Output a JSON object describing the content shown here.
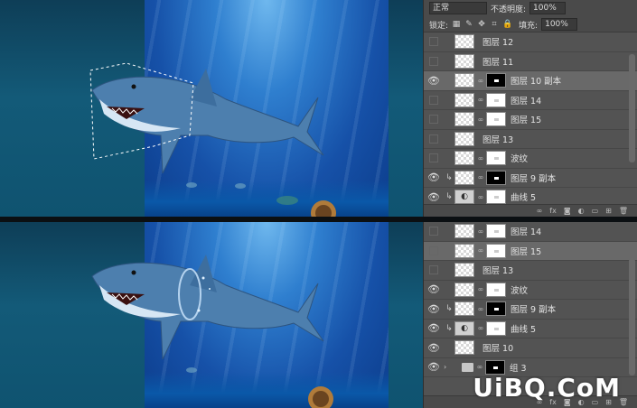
{
  "top": {
    "blend_mode": "正常",
    "opacity_label": "不透明度:",
    "opacity_value": "100%",
    "lock_label": "锁定:",
    "fill_label": "填充:",
    "fill_value": "100%",
    "layers": [
      {
        "name": "图层 12",
        "visible": false,
        "selected": false,
        "thumb": "checker",
        "mask": null,
        "clip": false
      },
      {
        "name": "图层 11",
        "visible": false,
        "selected": false,
        "thumb": "checker",
        "mask": null,
        "clip": false
      },
      {
        "name": "图层 10 副本",
        "visible": true,
        "selected": true,
        "thumb": "checker",
        "mask": "black",
        "clip": false
      },
      {
        "name": "图层 14",
        "visible": false,
        "selected": false,
        "thumb": "checker",
        "mask": "white",
        "clip": false
      },
      {
        "name": "图层 15",
        "visible": false,
        "selected": false,
        "thumb": "checker",
        "mask": "white",
        "clip": false
      },
      {
        "name": "图层 13",
        "visible": false,
        "selected": false,
        "thumb": "checker",
        "mask": null,
        "clip": false
      },
      {
        "name": "波纹",
        "visible": false,
        "selected": false,
        "thumb": "checker",
        "mask": "white",
        "clip": false
      },
      {
        "name": "图层 9 副本",
        "visible": true,
        "selected": false,
        "thumb": "checker",
        "mask": "black",
        "clip": true
      },
      {
        "name": "曲线 5",
        "visible": true,
        "selected": false,
        "thumb": "adjust",
        "mask": "white",
        "clip": true
      }
    ]
  },
  "bottom": {
    "layers": [
      {
        "name": "图层 14",
        "visible": false,
        "selected": false,
        "thumb": "checker",
        "mask": "white",
        "clip": false
      },
      {
        "name": "图层 15",
        "visible": false,
        "selected": true,
        "thumb": "checker",
        "mask": "white",
        "clip": false
      },
      {
        "name": "图层 13",
        "visible": false,
        "selected": false,
        "thumb": "checker",
        "mask": null,
        "clip": false
      },
      {
        "name": "波纹",
        "visible": true,
        "selected": false,
        "thumb": "checker",
        "mask": "white",
        "clip": false
      },
      {
        "name": "图层 9 副本",
        "visible": true,
        "selected": false,
        "thumb": "checker",
        "mask": "black",
        "clip": true
      },
      {
        "name": "曲线 5",
        "visible": true,
        "selected": false,
        "thumb": "adjust",
        "mask": "white",
        "clip": true
      },
      {
        "name": "图层 10",
        "visible": true,
        "selected": false,
        "thumb": "checker",
        "mask": null,
        "clip": false
      },
      {
        "name": "组 3",
        "visible": true,
        "selected": false,
        "thumb": "folder",
        "mask": "black",
        "clip": false,
        "group": true
      }
    ]
  },
  "footer_icons": [
    "link-icon",
    "fx-icon",
    "mask-icon",
    "adjustment-icon",
    "folder-icon",
    "new-layer-icon",
    "trash-icon"
  ],
  "footer_glyphs": {
    "link": "∞",
    "fx": "fx",
    "mask": "◙",
    "adjust": "◐",
    "folder": "▭",
    "new": "⊞",
    "trash": "🗑"
  },
  "watermark": "UiBQ.CoM",
  "colors": {
    "panel": "#535353",
    "selected_row": "#696969",
    "water": "#1f6fc4"
  }
}
